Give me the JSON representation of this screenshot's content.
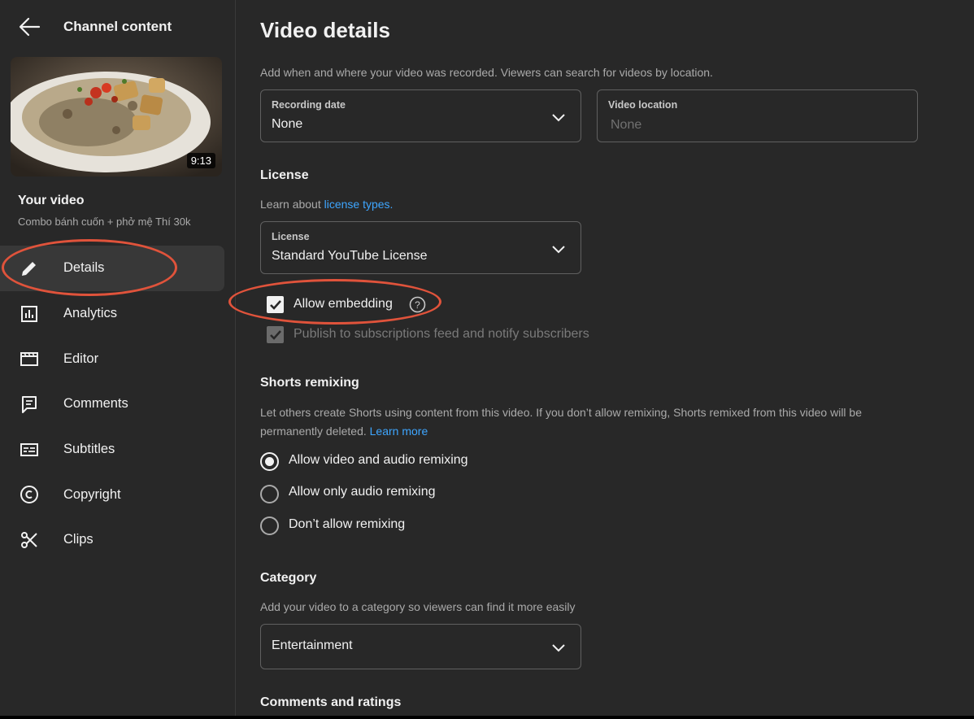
{
  "header": {
    "title": "Channel content"
  },
  "video": {
    "duration": "9:13",
    "section_label": "Your video",
    "name": "Combo bánh cuốn + phở mệ Thí 30k"
  },
  "nav": {
    "items": [
      {
        "label": "Details",
        "icon": "pencil-icon",
        "active": true
      },
      {
        "label": "Analytics",
        "icon": "analytics-icon"
      },
      {
        "label": "Editor",
        "icon": "clapperboard-icon"
      },
      {
        "label": "Comments",
        "icon": "comments-icon"
      },
      {
        "label": "Subtitles",
        "icon": "subtitles-icon"
      },
      {
        "label": "Copyright",
        "icon": "copyright-icon"
      },
      {
        "label": "Clips",
        "icon": "scissors-icon"
      }
    ]
  },
  "main": {
    "title": "Video details",
    "recording_desc": "Add when and where your video was recorded. Viewers can search for videos by location.",
    "recording_date": {
      "label": "Recording date",
      "value": "None"
    },
    "video_location": {
      "label": "Video location",
      "placeholder": "None"
    },
    "license": {
      "title": "License",
      "desc_prefix": "Learn about ",
      "desc_link": "license types.",
      "field_label": "License",
      "value": "Standard YouTube License"
    },
    "allow_embedding": {
      "label": "Allow embedding",
      "checked": true
    },
    "publish_feed": {
      "label": "Publish to subscriptions feed and notify subscribers",
      "checked": true,
      "disabled": true
    },
    "shorts": {
      "title": "Shorts remixing",
      "desc_line1": "Let others create Shorts using content from this video. If you don’t allow remixing, Shorts remixed from this video will be",
      "desc_line2": "permanently deleted. ",
      "desc_link": "Learn more",
      "options": [
        {
          "label": "Allow video and audio remixing",
          "selected": true
        },
        {
          "label": "Allow only audio remixing",
          "selected": false
        },
        {
          "label": "Don’t allow remixing",
          "selected": false
        }
      ]
    },
    "category": {
      "title": "Category",
      "desc": "Add your video to a category so viewers can find it more easily",
      "value": "Entertainment"
    },
    "comments_title": "Comments and ratings"
  },
  "colors": {
    "background": "#282828",
    "link": "#3ea6ff",
    "annotation": "#e0533b"
  }
}
